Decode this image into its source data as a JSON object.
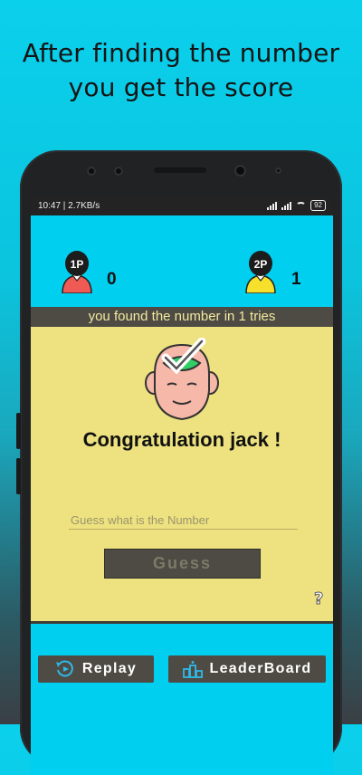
{
  "headline": {
    "line1": "After finding the number",
    "line2": "you get the score"
  },
  "status_bar": {
    "time_speed": "10:47 | 2.7KB/s",
    "battery": "92"
  },
  "players": {
    "p1": {
      "badge": "1P",
      "score": "0",
      "shirt_color": "#f05a55"
    },
    "p2": {
      "badge": "2P",
      "score": "1",
      "shirt_color": "#f6e02c"
    }
  },
  "result_banner": "you found the number in 1 tries",
  "congrats_text": "Congratulation jack !",
  "guess": {
    "placeholder": "Guess what is the Number",
    "button_label": "Guess"
  },
  "help_glyph": "?",
  "actions": {
    "replay_label": "Replay",
    "replay_icon": "replay-icon",
    "leaderboard_label": "LeaderBoard",
    "leaderboard_icon": "podium-icon"
  },
  "colors": {
    "screen_bg": "#00cff0",
    "card_bg": "#ede27f",
    "dark_bar": "#4d4b43",
    "banner_text": "#f2e9a0"
  }
}
